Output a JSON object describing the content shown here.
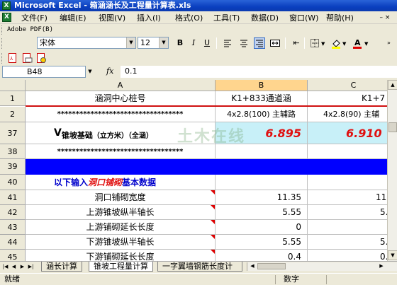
{
  "window": {
    "title": "Microsoft Excel - 箱涵涵长及工程量计算表.xls",
    "app_icon": "X"
  },
  "menu": {
    "items": [
      "文件(F)",
      "编辑(E)",
      "视图(V)",
      "插入(I)",
      "格式(O)",
      "工具(T)",
      "数据(D)",
      "窗口(W)",
      "帮助(H)"
    ]
  },
  "toolbar": {
    "pdf_label": "Adobe PDF(B)",
    "font_name": "宋体",
    "font_size": "12",
    "bold": "B",
    "italic": "I",
    "underline": "U"
  },
  "formula_bar": {
    "name_box": "B48",
    "fx": "fx",
    "formula": "0.1"
  },
  "columns": {
    "A": "A",
    "B": "B",
    "C": "C"
  },
  "rows": [
    {
      "num": "1",
      "a": "涵洞中心桩号",
      "b": "K1+833通道涵",
      "c": "K1+7"
    },
    {
      "num": "2",
      "a": "**********************************",
      "b": "4x2.8(100) 主辅路",
      "c": "4x2.8(90) 主辅"
    },
    {
      "num": "37",
      "a_main": "V",
      "a_sub": "锥坡基础",
      "a_rest": "（立方米）（全涵）",
      "b": "6.895",
      "c": "6.910"
    },
    {
      "num": "38",
      "a": "**********************************",
      "b": "",
      "c": ""
    },
    {
      "num": "39",
      "a": "",
      "b": "",
      "c": ""
    },
    {
      "num": "40",
      "a_pre": "以下输入",
      "a_em": "洞口铺砌",
      "a_post": "基本数据",
      "b": "",
      "c": ""
    },
    {
      "num": "41",
      "a": "洞口铺砌宽度",
      "b": "11.35",
      "c": "11."
    },
    {
      "num": "42",
      "a": "上游锥坡纵半轴长",
      "b": "5.55",
      "c": "5."
    },
    {
      "num": "43",
      "a": "上游铺砌延长长度",
      "b": "0",
      "c": ""
    },
    {
      "num": "44",
      "a": "下游锥坡纵半轴长",
      "b": "5.55",
      "c": "5."
    },
    {
      "num": "45",
      "a": "下游铺砌延长长度",
      "b": "0.4",
      "c": "0."
    }
  ],
  "sheet_tabs": [
    "涵长计算",
    "锥坡工程量计算",
    "一字翼墙钢筋长度计"
  ],
  "active_tab_index": 1,
  "status": {
    "ready": "就绪",
    "mode": "数字"
  },
  "watermark": "土木在线",
  "colors": {
    "title_bar": "#0a3fbf",
    "selected_header": "#ffd58e",
    "blue_row": "#0000ff",
    "highlight_fill": "#c8f0f8",
    "red_value": "#e01010",
    "blue_text": "#0000cc"
  }
}
